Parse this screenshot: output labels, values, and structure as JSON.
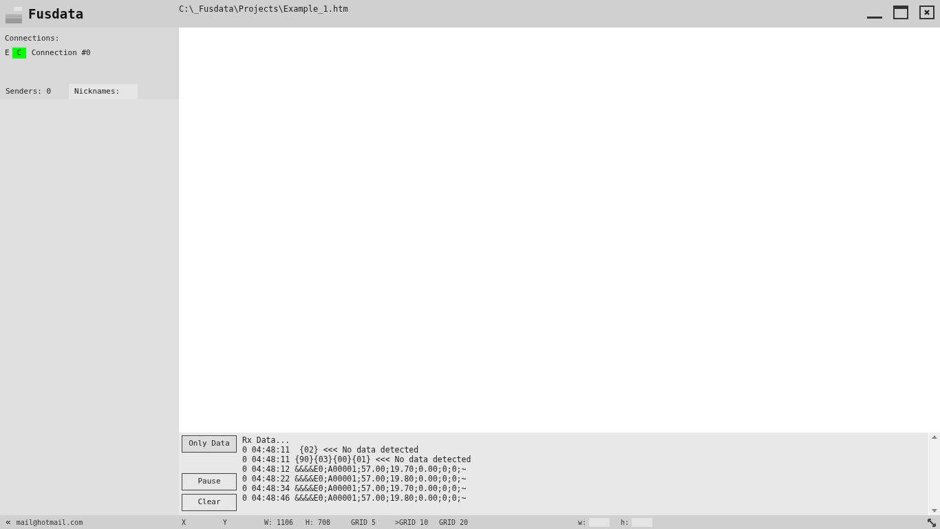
{
  "app": {
    "title": "Fusdata",
    "file_path": "C:\\_Fusdata\\Projects\\Example_1.htm"
  },
  "sidebar": {
    "connections_label": "Connections:",
    "connections": [
      {
        "prefix": "E",
        "badge": "C",
        "color": "#00ff00",
        "name": "Connection #0"
      }
    ],
    "senders": "Senders: 0",
    "nicknames": "Nicknames:"
  },
  "log": {
    "buttons": [
      "Only Data",
      "Pause",
      "Clear"
    ],
    "lines": [
      "Rx Data...",
      "0 04:48:11  {02} <<< No data detected",
      "0 04:48:11 {90}{03}{00}{01} <<< No data detected",
      "0 04:48:12 &&&&E0;A00001;57.00;19.70;0.00;0;0;~",
      "0 04:48:22 &&&&E0;A00001;57.00;19.80;0.00;0;0;~",
      "0 04:48:34 &&&&E0;A00001;57.00;19.70;0.00;0;0;~",
      "0 04:48:46 &&&&E0;A00001;57.00;19.80;0.00;0;0;~"
    ]
  },
  "status_bar": {
    "collapse": "«",
    "email": "mail@hotmail.com",
    "x": "X",
    "y": "Y",
    "w": "W: 1106",
    "h": "H: 708",
    "grids": [
      "GRID 5",
      ">GRID 10",
      "GRID 20"
    ],
    "w_label": "w:",
    "h_label": "h:"
  }
}
